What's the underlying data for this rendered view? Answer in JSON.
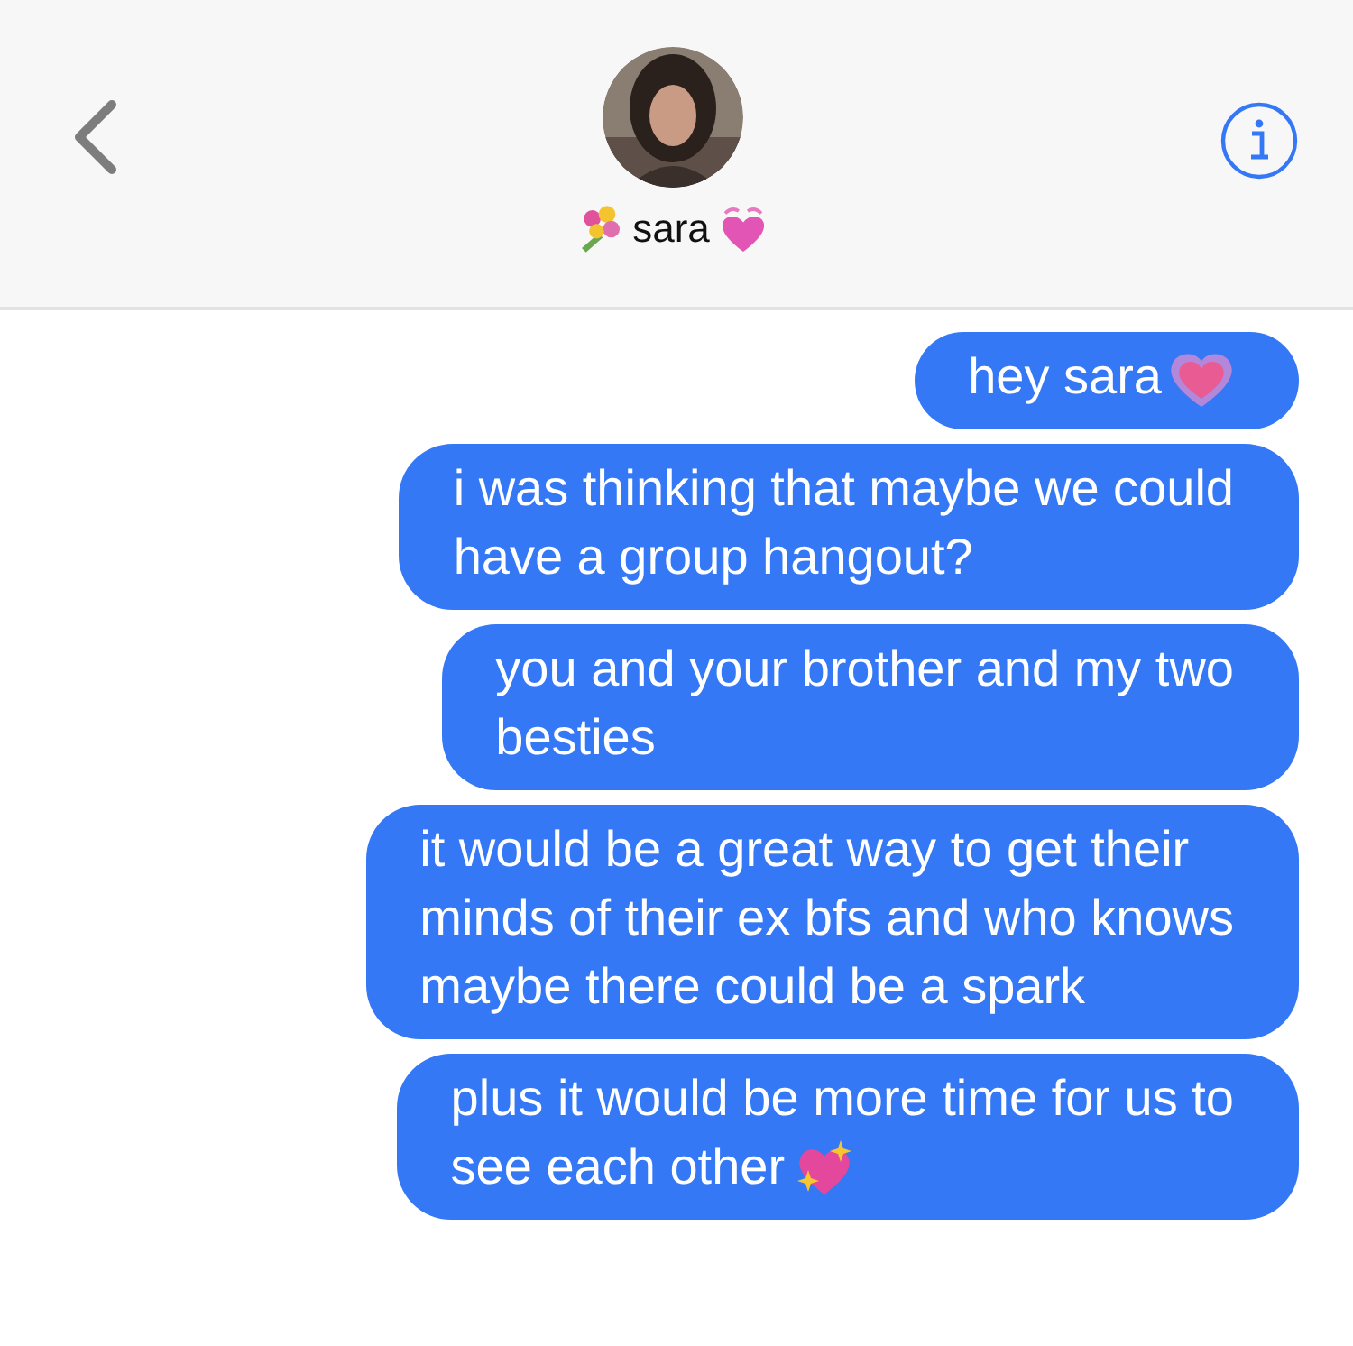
{
  "header": {
    "contact": {
      "name": "sara",
      "leading_icon": {
        "kind": "bouquet"
      },
      "trailing_icon": {
        "kind": "vibrating-heart"
      }
    }
  },
  "messages": [
    {
      "lines": [
        "hey sara"
      ],
      "trailing_icon": {
        "kind": "growing-heart"
      }
    },
    {
      "lines": [
        "i was thinking that maybe we could",
        "have a group hangout?"
      ]
    },
    {
      "lines": [
        "you and your brother and my two",
        "besties"
      ]
    },
    {
      "lines": [
        "it would be a great way to get their",
        "minds of their ex bfs and who knows",
        "maybe there could be a spark"
      ]
    },
    {
      "lines": [
        "plus it would be more time for us to",
        "see each other"
      ],
      "trailing_icon": {
        "kind": "sparkling-heart"
      }
    }
  ]
}
